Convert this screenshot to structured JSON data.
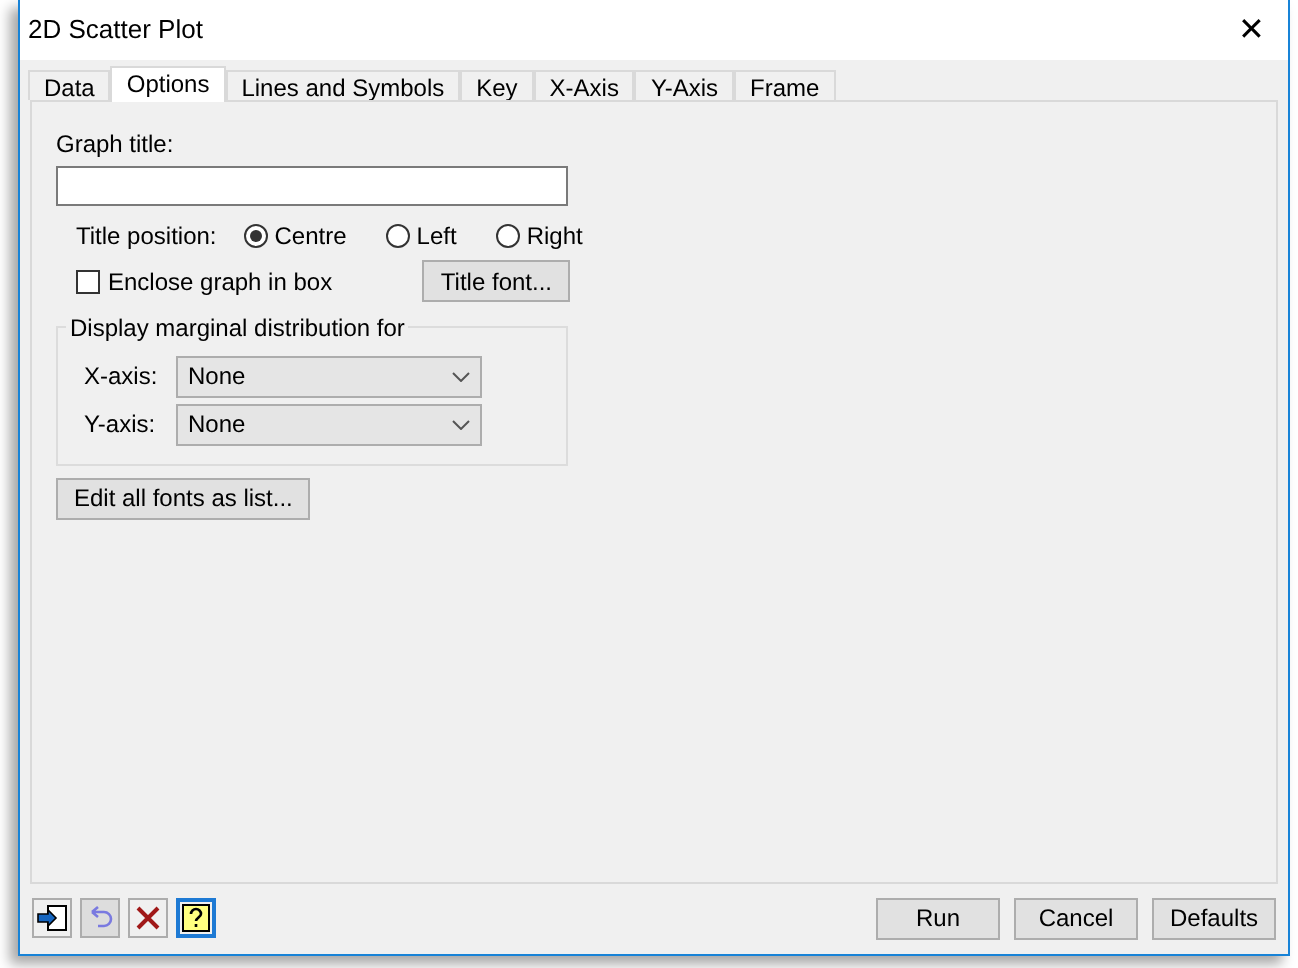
{
  "window": {
    "title": "2D Scatter Plot",
    "close": "✕"
  },
  "tabs": [
    {
      "label": "Data",
      "selected": false
    },
    {
      "label": "Options",
      "selected": true
    },
    {
      "label": "Lines and Symbols",
      "selected": false
    },
    {
      "label": "Key",
      "selected": false
    },
    {
      "label": "X-Axis",
      "selected": false
    },
    {
      "label": "Y-Axis",
      "selected": false
    },
    {
      "label": "Frame",
      "selected": false
    }
  ],
  "graph_title": {
    "label": "Graph title:"
  },
  "title_position": {
    "label": "Title position:",
    "options": [
      {
        "label": "Centre",
        "selected": true
      },
      {
        "label": "Left",
        "selected": false
      },
      {
        "label": "Right",
        "selected": false
      }
    ]
  },
  "enclose": {
    "label": "Enclose graph in box",
    "checked": false
  },
  "title_font_button": "Title font...",
  "marginal": {
    "legend": "Display marginal distribution for",
    "fields": [
      {
        "label": "X-axis:",
        "value": "None"
      },
      {
        "label": "Y-axis:",
        "value": "None"
      }
    ]
  },
  "edit_fonts_button": "Edit all fonts as list...",
  "toolbar": [
    {
      "kind": "pin",
      "disabled": false
    },
    {
      "kind": "undo",
      "disabled": true
    },
    {
      "kind": "clear",
      "disabled": false
    },
    {
      "kind": "help",
      "disabled": false
    }
  ],
  "buttons": [
    "Run",
    "Cancel",
    "Defaults"
  ]
}
